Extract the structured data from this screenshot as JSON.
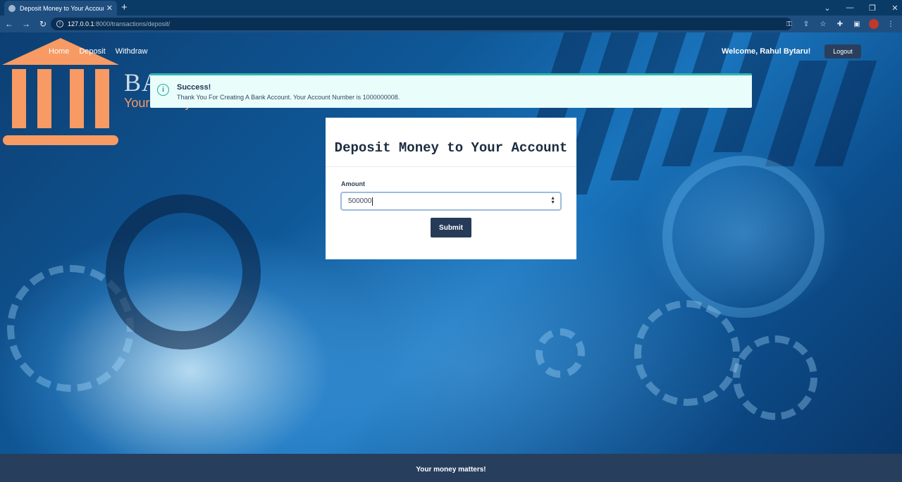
{
  "browser": {
    "tab_title": "Deposit Money to Your Account",
    "url_host": "127.0.0.1",
    "url_path": ":8000/transactions/deposit/"
  },
  "site": {
    "logo_text": "BANK OF WEIR",
    "logo_tagline": "Your money matters",
    "nav": [
      "Home",
      "Deposit",
      "Withdraw"
    ],
    "welcome": "Welcome, Rahul Bytaru!",
    "logout_label": "Logout",
    "accent_color": "#F79A63"
  },
  "alert": {
    "title": "Success!",
    "message": "Thank You For Creating A Bank Account. Your Account Number is 1000000008."
  },
  "form": {
    "heading": "Deposit Money to Your Account",
    "amount_label": "Amount",
    "amount_value": "500000",
    "submit_label": "Submit"
  },
  "footer": {
    "text": "Your money matters!"
  }
}
